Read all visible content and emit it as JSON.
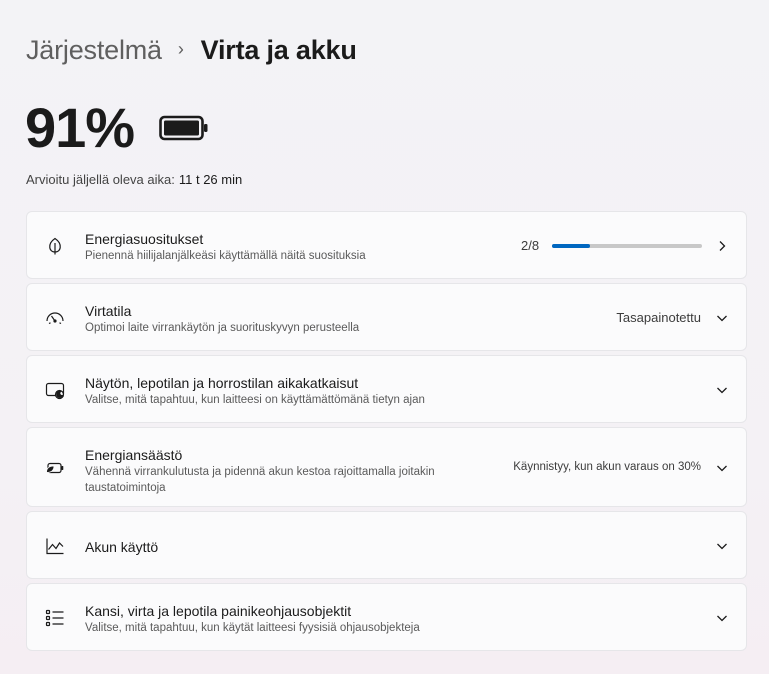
{
  "header": {
    "parent": "Järjestelmä",
    "separator": "›",
    "title": "Virta ja akku"
  },
  "battery": {
    "percent": "91%",
    "estimate_label": "Arvioitu jäljellä oleva aika:",
    "estimate_value": "11 t 26 min",
    "level": 0.91
  },
  "cards": {
    "recommendations": {
      "title": "Energiasuositukset",
      "desc": "Pienennä hiilijalanjälkeäsi käyttämällä näitä suosituksia",
      "progress_text": "2/8",
      "progress_fraction": 0.25,
      "icon": "leaf-icon"
    },
    "power_mode": {
      "title": "Virtatila",
      "desc": "Optimoi laite virrankäytön ja suorituskyvyn perusteella",
      "value": "Tasapainotettu",
      "icon": "gauge-icon"
    },
    "screen_sleep": {
      "title": "Näytön, lepotilan ja horrostilan aikakatkaisut",
      "desc": "Valitse, mitä tapahtuu, kun laitteesi on käyttämättömänä tietyn ajan",
      "icon": "screen-sleep-icon"
    },
    "energy_saver": {
      "title": "Energiansäästö",
      "desc_line1": "Vähennä virrankulutusta ja pidennä akun kestoa rajoittamalla joitakin",
      "desc_line2": "taustatoimintoja",
      "value": "Käynnistyy, kun akun varaus on 30%",
      "icon": "battery-saver-icon"
    },
    "battery_usage": {
      "title": "Akun käyttö",
      "icon": "line-chart-icon"
    },
    "lid_buttons": {
      "title": "Kansi, virta ja lepotila painikeohjausobjektit",
      "desc": "Valitse, mitä tapahtuu, kun käytät laitteesi fyysisiä ohjausobjekteja",
      "icon": "list-icon"
    }
  },
  "colors": {
    "accent": "#0067c0",
    "track": "#c8c8c8"
  }
}
